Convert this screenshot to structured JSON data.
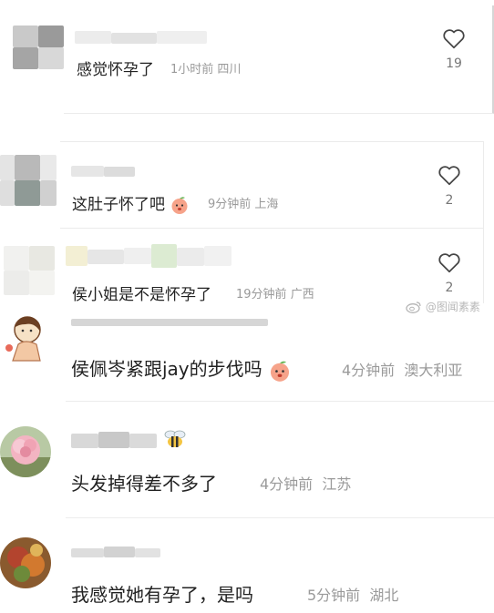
{
  "comments": [
    {
      "text": "感觉怀孕了",
      "time": "1小时前",
      "location": "四川",
      "likes": "19"
    },
    {
      "text": "这肚子怀了吧",
      "time": "9分钟前",
      "location": "上海",
      "likes": "2"
    },
    {
      "text": "侯小姐是不是怀孕了",
      "time": "19分钟前",
      "location": "广西",
      "likes": "2"
    },
    {
      "text": "侯佩岑紧跟jay的步伐吗",
      "time": "4分钟前",
      "location": "澳大利亚"
    },
    {
      "text": "头发掉得差不多了",
      "time": "4分钟前",
      "location": "江苏"
    },
    {
      "text": "我感觉她有孕了，是吗",
      "time": "5分钟前",
      "location": "湖北"
    }
  ],
  "watermark": {
    "text": "@图闻素素"
  },
  "icons": {
    "like": "heart-outline-icon",
    "emoji": "peach-face-emoji-icon",
    "weibo": "weibo-logo-icon",
    "bee": "bee-icon"
  }
}
